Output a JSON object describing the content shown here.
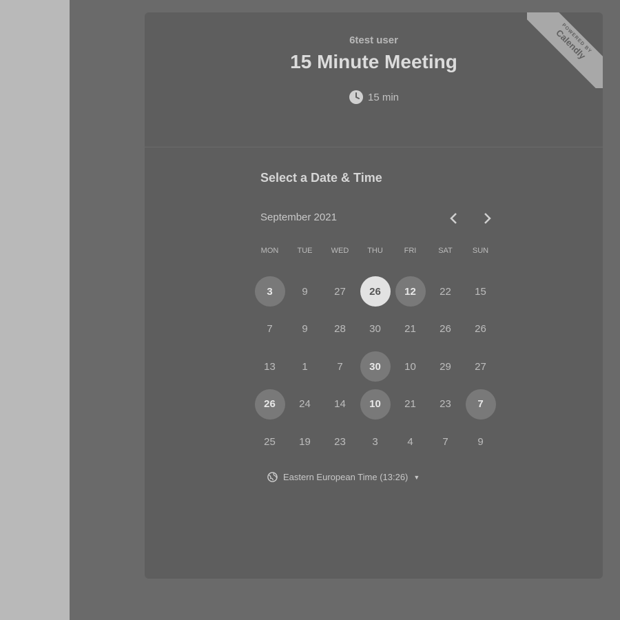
{
  "event": {
    "organizer": "6test user",
    "title": "15 Minute Meeting",
    "duration": "15 min"
  },
  "badge": {
    "line1": "POWERED BY",
    "line2": "Calendly"
  },
  "scheduler": {
    "heading": "Select a Date & Time",
    "month": "September 2021",
    "weekdays": [
      "MON",
      "TUE",
      "WED",
      "THU",
      "FRI",
      "SAT",
      "SUN"
    ],
    "days": [
      {
        "n": "3",
        "s": "available"
      },
      {
        "n": "9",
        "s": "none"
      },
      {
        "n": "27",
        "s": "none"
      },
      {
        "n": "26",
        "s": "selected"
      },
      {
        "n": "12",
        "s": "available"
      },
      {
        "n": "22",
        "s": "none"
      },
      {
        "n": "15",
        "s": "none"
      },
      {
        "n": "7",
        "s": "none"
      },
      {
        "n": "9",
        "s": "none"
      },
      {
        "n": "28",
        "s": "none"
      },
      {
        "n": "30",
        "s": "none"
      },
      {
        "n": "21",
        "s": "none"
      },
      {
        "n": "26",
        "s": "none"
      },
      {
        "n": "26",
        "s": "none"
      },
      {
        "n": "13",
        "s": "none"
      },
      {
        "n": "1",
        "s": "none"
      },
      {
        "n": "7",
        "s": "none"
      },
      {
        "n": "30",
        "s": "available"
      },
      {
        "n": "10",
        "s": "none"
      },
      {
        "n": "29",
        "s": "none"
      },
      {
        "n": "27",
        "s": "none"
      },
      {
        "n": "26",
        "s": "available"
      },
      {
        "n": "24",
        "s": "none"
      },
      {
        "n": "14",
        "s": "none"
      },
      {
        "n": "10",
        "s": "available"
      },
      {
        "n": "21",
        "s": "none"
      },
      {
        "n": "23",
        "s": "none"
      },
      {
        "n": "7",
        "s": "available"
      },
      {
        "n": "25",
        "s": "none"
      },
      {
        "n": "19",
        "s": "none"
      },
      {
        "n": "23",
        "s": "none"
      },
      {
        "n": "3",
        "s": "none"
      },
      {
        "n": "4",
        "s": "none"
      },
      {
        "n": "7",
        "s": "none"
      },
      {
        "n": "9",
        "s": "none"
      }
    ],
    "timezone": "Eastern European Time (13:26)"
  },
  "icons": {
    "duration": "clock-icon",
    "timezone": "globe-icon",
    "prev": "chevron-left-icon",
    "next": "chevron-right-icon",
    "timezone_toggle": "caret-down-icon"
  },
  "colors": {
    "overlay": "#6a6a6a",
    "card": "#5e5e5e",
    "selected_day": "#e2e2e2",
    "available_day": "#797979"
  }
}
